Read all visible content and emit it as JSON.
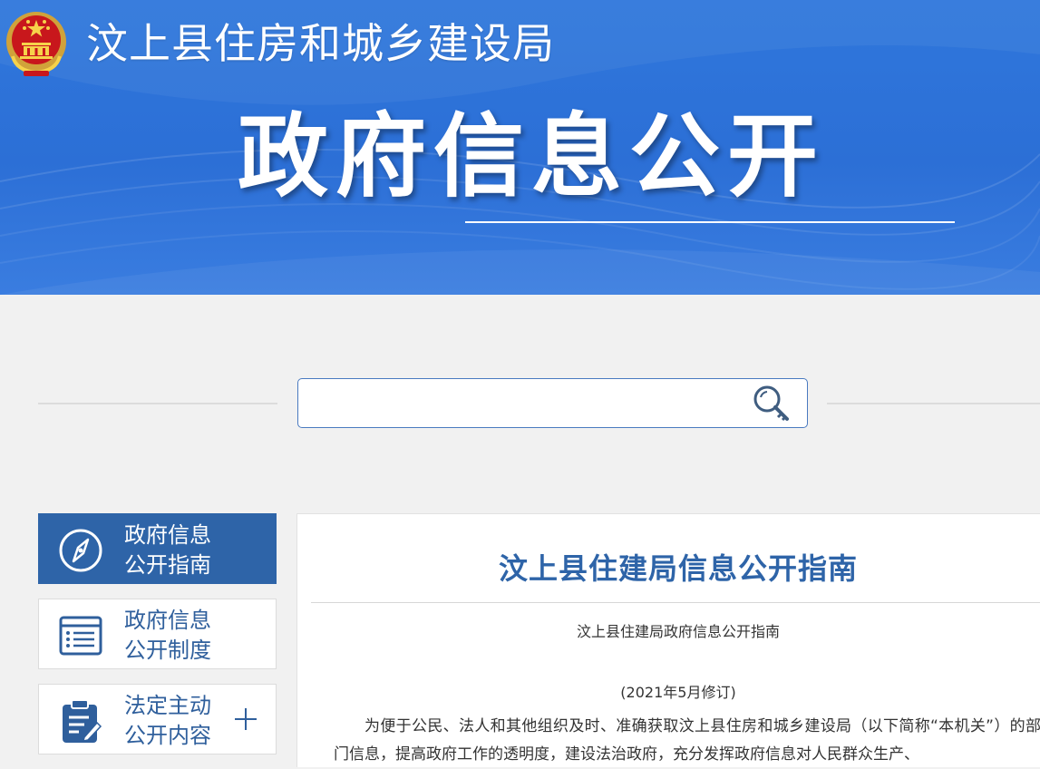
{
  "header": {
    "site_title": "汶上县住房和城乡建设局",
    "section_title": "政府信息公开",
    "emblem_icon": "national-emblem-icon"
  },
  "search": {
    "placeholder": "",
    "icon": "search-icon"
  },
  "sidebar": {
    "items": [
      {
        "label": "政府信息\n公开指南",
        "icon": "compass-icon",
        "active": true
      },
      {
        "label": "政府信息\n公开制度",
        "icon": "document-list-icon",
        "active": false
      },
      {
        "label": "法定主动\n公开内容",
        "icon": "clipboard-edit-icon",
        "active": false,
        "expand_icon": "plus-icon"
      }
    ]
  },
  "article": {
    "title": "汶上县住建局信息公开指南",
    "subtitle": "汶上县住建局政府信息公开指南",
    "date": "(2021年5月修订)",
    "body": "为便于公民、法人和其他组织及时、准确获取汶上县住房和城乡建设局（以下简称“本机关”）的部门信息，提高政府工作的透明度，建设法治政府，充分发挥政府信息对人民群众生产、"
  },
  "colors": {
    "banner_blue": "#2f77dc",
    "accent_blue": "#2e64a8",
    "page_bg": "#f1f1f1"
  }
}
